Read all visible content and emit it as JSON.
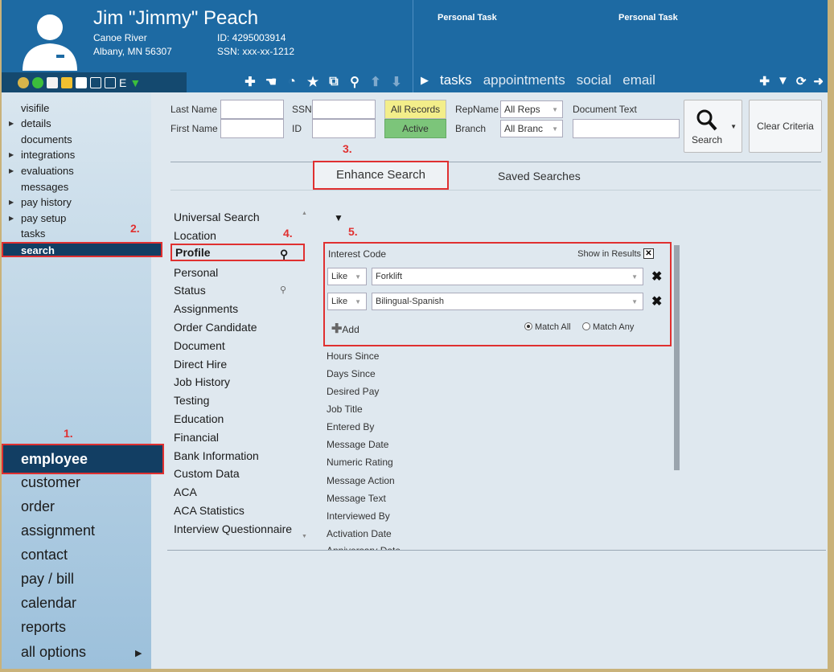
{
  "employee": {
    "name": "Jim \"Jimmy\" Peach",
    "city_line": "Canoe River",
    "address_line": "Albany, MN 56307",
    "id_line": "ID: 4295003914",
    "ssn_line": "SSN: xxx-xx-1212"
  },
  "header": {
    "personal_task_1": "Personal Task",
    "personal_task_2": "Personal Task",
    "tabs": [
      "tasks",
      "appointments",
      "social",
      "email"
    ]
  },
  "sidebar": {
    "sub_items": [
      "visifile",
      "details",
      "documents",
      "integrations",
      "evaluations",
      "messages",
      "pay history",
      "pay setup",
      "tasks",
      "search"
    ],
    "main_items": [
      "employee",
      "customer",
      "order",
      "assignment",
      "contact",
      "pay / bill",
      "calendar",
      "reports",
      "all options"
    ]
  },
  "annotations": {
    "a1": "1.",
    "a2": "2.",
    "a3": "3.",
    "a4": "4.",
    "a5": "5."
  },
  "search_form": {
    "last_name_label": "Last Name",
    "first_name_label": "First Name",
    "ssn_label": "SSN",
    "id_label": "ID",
    "all_records": "All Records",
    "active": "Active",
    "repname_label": "RepName",
    "branch_label": "Branch",
    "all_reps": "All Reps",
    "all_branch": "All Branc",
    "document_text_label": "Document Text",
    "search_button": "Search",
    "clear_criteria": "Clear Criteria"
  },
  "tabs": {
    "enhance": "Enhance Search",
    "saved": "Saved Searches"
  },
  "categories": [
    "Universal Search",
    "Location",
    "Profile",
    "Personal",
    "Status",
    "Assignments",
    "Order Candidate",
    "Document",
    "Direct Hire",
    "Job History",
    "Testing",
    "Education",
    "Financial",
    "Bank Information",
    "Custom Data",
    "ACA",
    "ACA Statistics",
    "Interview Questionnaire"
  ],
  "criteria": {
    "title": "Interest Code",
    "show_in_results": "Show in Results",
    "rows": [
      {
        "operator": "Like",
        "value": "Forklift"
      },
      {
        "operator": "Like",
        "value": "Bilingual-Spanish"
      }
    ],
    "add_label": "Add",
    "match_all": "Match All",
    "match_any": "Match Any"
  },
  "fields": [
    "Hours Since",
    "Days Since",
    "Desired Pay",
    "Job Title",
    "Entered By",
    "Message Date",
    "Numeric Rating",
    "Message Action",
    "Message Text",
    "Interviewed By",
    "Activation Date",
    "Anniversary Date"
  ]
}
